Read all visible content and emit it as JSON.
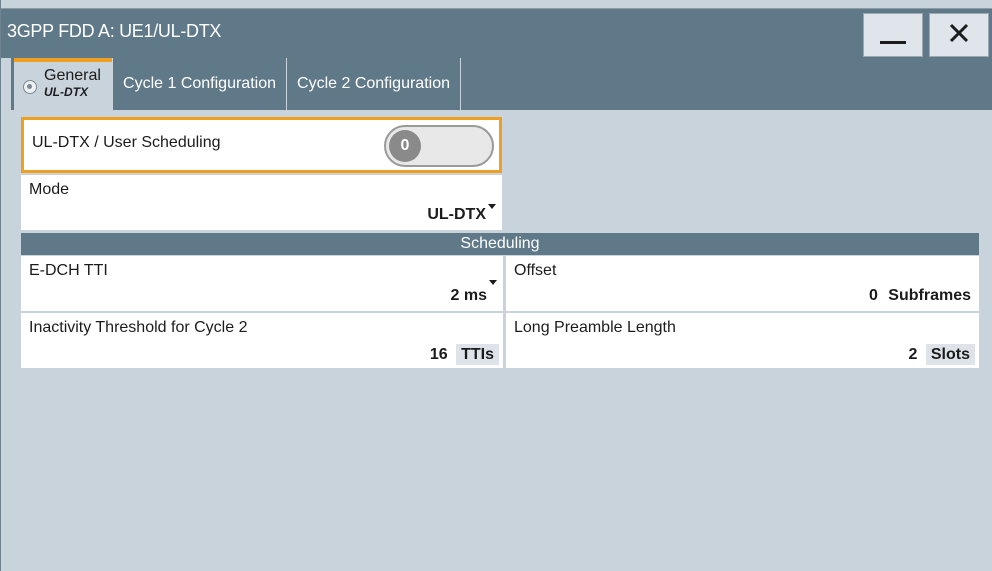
{
  "window": {
    "title": "3GPP FDD A: UE1/UL-DTX",
    "minimize_symbol": "—",
    "close_symbol": "✕"
  },
  "tabs": [
    {
      "label": "General",
      "sublabel": "UL-DTX",
      "active": true
    },
    {
      "label": "Cycle 1 Configuration",
      "active": false
    },
    {
      "label": "Cycle 2 Configuration",
      "active": false
    }
  ],
  "general": {
    "uldtx_user_scheduling": {
      "label": "UL-DTX / User Scheduling",
      "state": "0"
    },
    "mode": {
      "label": "Mode",
      "value": "UL-DTX"
    }
  },
  "scheduling": {
    "header": "Scheduling",
    "edch_tti": {
      "label": "E-DCH TTI",
      "value": "2 ms"
    },
    "offset": {
      "label": "Offset",
      "value": "0",
      "unit": "Subframes"
    },
    "inactivity_threshold": {
      "label": "Inactivity Threshold for Cycle 2",
      "value": "16",
      "unit": "TTIs"
    },
    "long_preamble_length": {
      "label": "Long Preamble Length",
      "value": "2",
      "unit": "Slots"
    }
  },
  "colors": {
    "titlebar": "#5f7989",
    "background": "#c9d3db",
    "accent": "#f0a020"
  }
}
